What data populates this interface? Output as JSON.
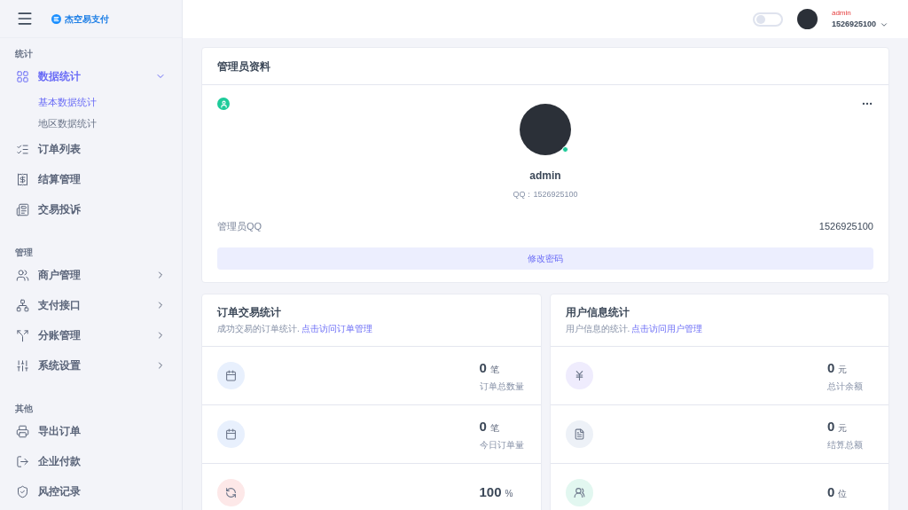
{
  "brand": {
    "name": "杰空易支付"
  },
  "header": {
    "theme_toggle": {
      "on": false
    },
    "user": {
      "name": "admin",
      "account": "1526925100"
    }
  },
  "sidebar": {
    "sections": [
      {
        "title": "统计",
        "items": [
          {
            "label": "数据统计",
            "selected": true,
            "expanded": true,
            "children": [
              {
                "label": "基本数据统计",
                "selected": true
              },
              {
                "label": "地区数据统计",
                "selected": false
              }
            ]
          },
          {
            "label": "订单列表",
            "selected": false
          },
          {
            "label": "结算管理",
            "selected": false
          },
          {
            "label": "交易投诉",
            "selected": false
          }
        ]
      },
      {
        "title": "管理",
        "items": [
          {
            "label": "商户管理",
            "selected": false,
            "expanded": false
          },
          {
            "label": "支付接口",
            "selected": false,
            "expanded": false
          },
          {
            "label": "分账管理",
            "selected": false,
            "expanded": false
          },
          {
            "label": "系统设置",
            "selected": false,
            "expanded": false
          }
        ]
      },
      {
        "title": "其他",
        "items": [
          {
            "label": "导出订单",
            "selected": false
          },
          {
            "label": "企业付款",
            "selected": false
          },
          {
            "label": "风控记录",
            "selected": false
          }
        ]
      }
    ]
  },
  "profile": {
    "title": "管理员资料",
    "name": "admin",
    "online": true,
    "qq_line": "QQ：1526925100",
    "field_label": "管理员QQ",
    "field_value": "1526925100",
    "button": "修改密码"
  },
  "panels": [
    {
      "title": "订单交易统计",
      "subtitle": "成功交易的订单统计.",
      "link": "点击访问订单管理",
      "stats": [
        {
          "value": "0",
          "unit": "笔",
          "label": "订单总数量",
          "color": "#e8f0fd"
        },
        {
          "value": "0",
          "unit": "笔",
          "label": "今日订单量",
          "color": "#e8f0fd"
        },
        {
          "value": "100",
          "unit": "%",
          "color": "#fde8e8"
        }
      ]
    },
    {
      "title": "用户信息统计",
      "subtitle": "用户信息的统计.",
      "link": "点击访问用户管理",
      "stats": [
        {
          "value": "0",
          "unit": "元",
          "label": "总计余额",
          "color": "#efecfd"
        },
        {
          "value": "0",
          "unit": "元",
          "label": "结算总额",
          "color": "#edf1f7"
        },
        {
          "value": "0",
          "unit": "位",
          "color": "#e2f7f0"
        }
      ]
    }
  ]
}
